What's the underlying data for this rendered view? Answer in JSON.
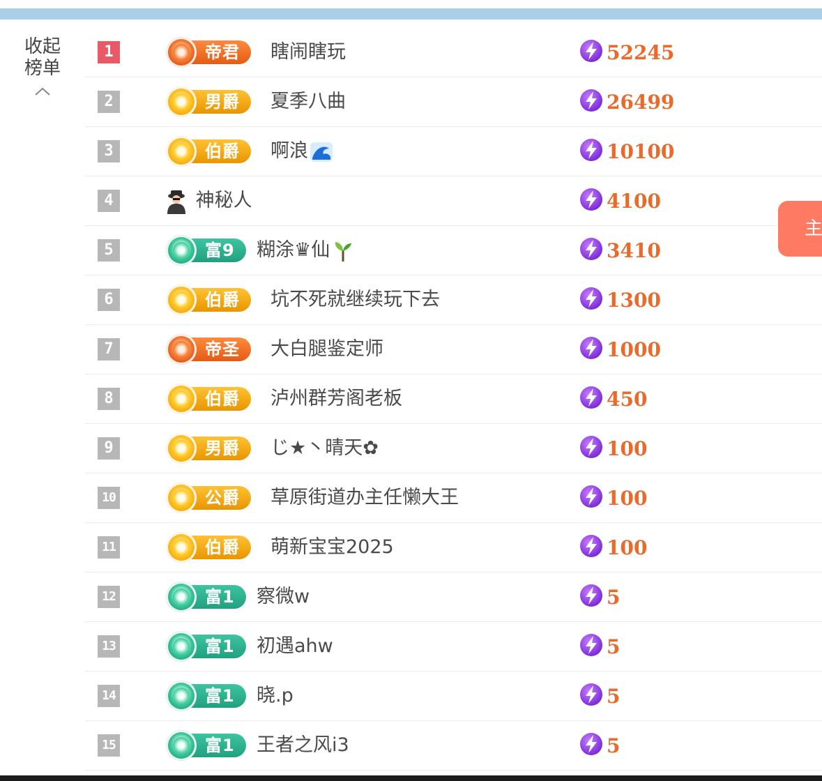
{
  "collapse": {
    "line1": "收起",
    "line2": "榜单"
  },
  "side_tab": {
    "label": "主"
  },
  "rows": [
    {
      "rank": "1",
      "tier": "red",
      "title": "帝君",
      "name": "瞎闹瞎玩",
      "score": "52245"
    },
    {
      "rank": "2",
      "tier": "gold",
      "title": "男爵",
      "name": "夏季八曲",
      "score": "26499"
    },
    {
      "rank": "3",
      "tier": "gold",
      "title": "伯爵",
      "name": "啊浪",
      "score": "10100",
      "emoji": "wave-icon"
    },
    {
      "rank": "4",
      "tier": "none",
      "title": "",
      "name": "神秘人",
      "score": "4100",
      "prefix_icon": "mystery-person-icon"
    },
    {
      "rank": "5",
      "tier": "teal",
      "title": "富9",
      "name": "糊涂♛仙",
      "score": "3410",
      "emoji": "sprout-icon"
    },
    {
      "rank": "6",
      "tier": "gold",
      "title": "伯爵",
      "name": "坑不死就继续玩下去",
      "score": "1300"
    },
    {
      "rank": "7",
      "tier": "red",
      "title": "帝圣",
      "name": "大白腿鉴定师",
      "score": "1000"
    },
    {
      "rank": "8",
      "tier": "gold",
      "title": "伯爵",
      "name": "泸州群芳阁老板",
      "score": "450"
    },
    {
      "rank": "9",
      "tier": "gold",
      "title": "男爵",
      "name": "じ★丶晴天✿",
      "score": "100"
    },
    {
      "rank": "10",
      "tier": "gold",
      "title": "公爵",
      "name": "草原街道办主任懒大王",
      "score": "100"
    },
    {
      "rank": "11",
      "tier": "gold",
      "title": "伯爵",
      "name": "萌新宝宝2025",
      "score": "100"
    },
    {
      "rank": "12",
      "tier": "teal",
      "title": "富1",
      "name": "察微w",
      "score": "5"
    },
    {
      "rank": "13",
      "tier": "teal",
      "title": "富1",
      "name": "初遇ahw",
      "score": "5"
    },
    {
      "rank": "14",
      "tier": "teal",
      "title": "富1",
      "name": "晓.p",
      "score": "5"
    },
    {
      "rank": "15",
      "tier": "teal",
      "title": "富1",
      "name": "王者之风i3",
      "score": "5"
    }
  ]
}
